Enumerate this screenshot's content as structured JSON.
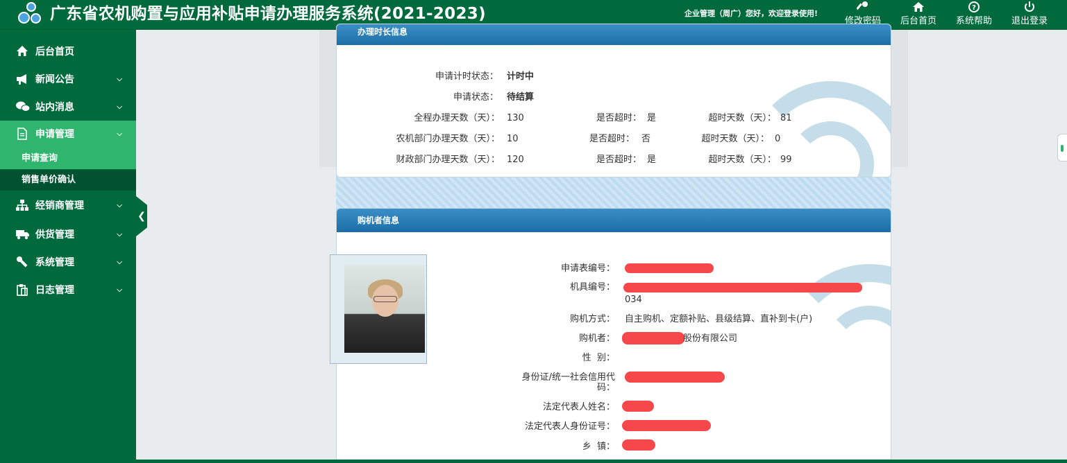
{
  "header": {
    "title": "广东省农机购置与应用补贴申请办理服务系统(2021-2023)",
    "welcome": "企业管理（周广）您好，欢迎登录使用!",
    "buttons": [
      {
        "label": "修改密码",
        "icon": "key-icon"
      },
      {
        "label": "后台首页",
        "icon": "home-icon"
      },
      {
        "label": "系统帮助",
        "icon": "help-icon"
      },
      {
        "label": "退出登录",
        "icon": "power-icon"
      }
    ]
  },
  "sidebar": {
    "items": [
      {
        "label": "后台首页",
        "icon": "home-icon"
      },
      {
        "label": "新闻公告",
        "icon": "megaphone-icon"
      },
      {
        "label": "站内消息",
        "icon": "chat-icon"
      },
      {
        "label": "申请管理",
        "icon": "document-icon"
      },
      {
        "label": "经销商管理",
        "icon": "sitemap-icon"
      },
      {
        "label": "供货管理",
        "icon": "truck-icon"
      },
      {
        "label": "系统管理",
        "icon": "wrench-icon"
      },
      {
        "label": "日志管理",
        "icon": "clipboard-icon"
      }
    ],
    "subitems": [
      {
        "label": "申请查询"
      },
      {
        "label": "销售单价确认"
      }
    ]
  },
  "time_panel": {
    "title": "办理时长信息",
    "timing_status_label": "申请计时状态：",
    "timing_status_value": "计时中",
    "status_label": "申请状态：",
    "status_value": "待结算",
    "rows": [
      {
        "label": "全程办理天数（天）：",
        "days": "130",
        "overdue_label": "是否超时：",
        "overdue": "是",
        "over_days_label": "超时天数（天）：",
        "over_days": "81"
      },
      {
        "label": "农机部门办理天数（天）：",
        "days": "10",
        "overdue_label": "是否超时：",
        "overdue": "否",
        "over_days_label": "超时天数（天）：",
        "over_days": "0"
      },
      {
        "label": "财政部门办理天数（天）：",
        "days": "120",
        "overdue_label": "是否超时：",
        "overdue": "是",
        "over_days_label": "超时天数（天）：",
        "over_days": "99"
      }
    ]
  },
  "buyer_panel": {
    "title": "购机者信息",
    "form_no_label": "申请表编号：",
    "machine_no_label": "机具编号：",
    "machine_no_suffix": "034",
    "purchase_method_label": "购机方式：",
    "purchase_method": "自主购机、定额补贴、县级结算、直补到卡(户)",
    "buyer_label": "购机者：",
    "buyer_suffix": "股份有限公司",
    "gender_label": "性  别：",
    "id_label_line1": "身份证/统一社会信用代",
    "id_label_line2": "码：",
    "legal_name_label": "法定代表人姓名：",
    "legal_id_label": "法定代表人身份证号：",
    "town_label": "乡  镇："
  },
  "colors": {
    "header_bg": "#006a3c",
    "sidebar_active": "#2fb56d",
    "panel_head": "#1d6ea6",
    "redaction": "#f6484b"
  }
}
